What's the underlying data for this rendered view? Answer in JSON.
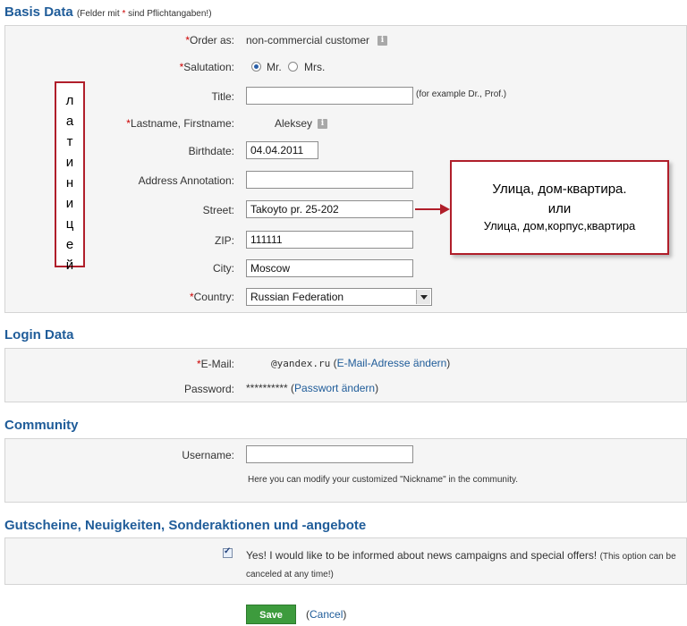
{
  "basis": {
    "title": "Basis Data",
    "note_prefix": "(Felder mit ",
    "note_star": "*",
    "note_suffix": " sind Pflichtangaben!)",
    "order_as": {
      "label": "Order as:",
      "value": "non-commercial customer"
    },
    "salutation": {
      "label": "Salutation:",
      "options": [
        "Mr.",
        "Mrs."
      ],
      "selected": "Mr."
    },
    "title_field": {
      "label": "Title:",
      "value": "",
      "hint": "(for example Dr., Prof.)"
    },
    "name": {
      "label": "Lastname, Firstname:",
      "value": "Aleksey"
    },
    "birthdate": {
      "label": "Birthdate:",
      "value": "04.04.2011"
    },
    "address_annotation": {
      "label": "Address Annotation:",
      "value": ""
    },
    "street": {
      "label": "Street:",
      "value": "Takoyto pr. 25-202"
    },
    "zip": {
      "label": "ZIP:",
      "value": "111111"
    },
    "city": {
      "label": "City:",
      "value": "Moscow"
    },
    "country": {
      "label": "Country:",
      "value": "Russian Federation"
    }
  },
  "annotation_vertical": [
    "л",
    "а",
    "т",
    "и",
    "н",
    "и",
    "ц",
    "е",
    "й"
  ],
  "callout": {
    "line1": "Улица, дом-квартира.",
    "line2": "или",
    "line3": "Улица, дом,корпус,квартира"
  },
  "login": {
    "title": "Login Data",
    "email": {
      "label": "E-Mail:",
      "value": "@yandex.ru",
      "link": "E-Mail-Adresse ändern"
    },
    "password": {
      "label": "Password:",
      "value": "**********",
      "link": "Passwort ändern"
    }
  },
  "community": {
    "title": "Community",
    "username": {
      "label": "Username:",
      "value": ""
    },
    "hint": "Here you can modify your customized \"Nickname\" in the community."
  },
  "news": {
    "title": "Gutscheine, Neuigkeiten, Sonderaktionen und -angebote",
    "checked": true,
    "text_main": "Yes! I would like to be informed about news campaigns and special offers!",
    "text_small": "(This option can be",
    "text_small2": "canceled at any time!)"
  },
  "actions": {
    "save": "Save",
    "cancel": "Cancel"
  }
}
